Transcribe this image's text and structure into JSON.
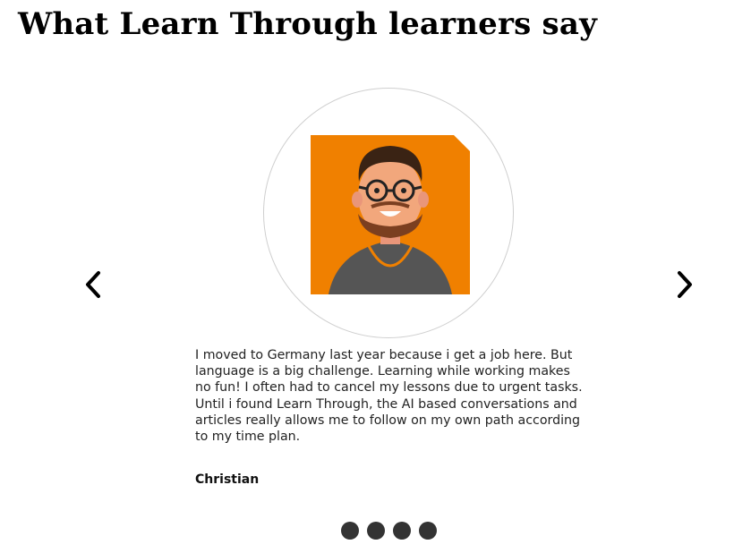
{
  "section": {
    "title": "What Learn Through learners say"
  },
  "carousel": {
    "prev_icon": "chevron-left-icon",
    "next_icon": "chevron-right-icon",
    "testimonial": {
      "avatar_icon": "bearded-man-with-glasses-avatar",
      "avatar_background": "#F08000",
      "quote": "I moved to Germany last year because i get a job here. But language is a big challenge. Learning while working makes no fun! I often had to cancel my lessons due to urgent tasks. Until i found Learn Through, the AI based conversations and articles really allows me to follow on my own path according to my time plan.",
      "author": "Christian"
    },
    "dots": [
      {
        "slide": 1
      },
      {
        "slide": 2
      },
      {
        "slide": 3
      },
      {
        "slide": 4
      }
    ],
    "dot_color": "#333333"
  }
}
